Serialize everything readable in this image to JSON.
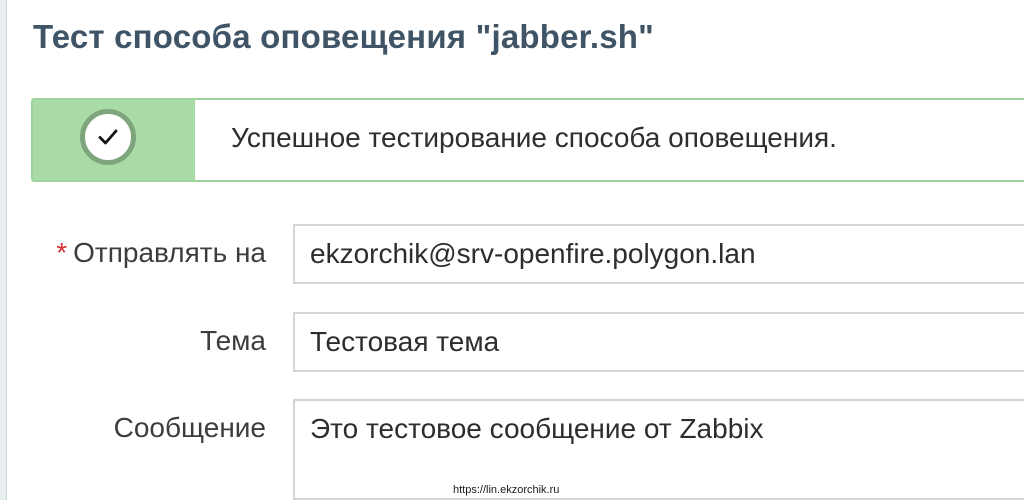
{
  "dialog": {
    "title": "Тест способа оповещения \"jabber.sh\""
  },
  "message": {
    "text": "Успешное тестирование способа оповещения.",
    "icon": "check-circle-icon",
    "color_border": "#9ed49b",
    "color_icon_bg": "#a9dba6"
  },
  "form": {
    "send_to": {
      "required_mark": "*",
      "label": "Отправлять на",
      "value": "ekzorchik@srv-openfire.polygon.lan"
    },
    "subject": {
      "label": "Тема",
      "value": "Тестовая тема"
    },
    "message": {
      "label": "Сообщение",
      "value": "Это тестовое сообщение от Zabbix"
    }
  },
  "footer": {
    "link_text": "https://lin.ekzorchik.ru"
  }
}
